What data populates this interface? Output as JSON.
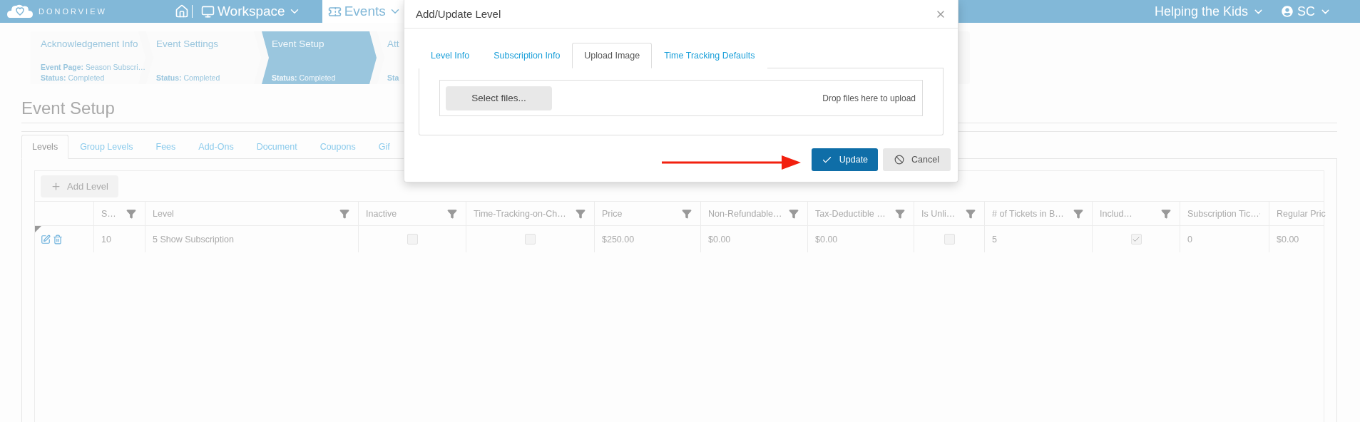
{
  "topbar": {
    "logo": "DONORVIEW",
    "nav": [
      {
        "kind": "workspace",
        "label": "Workspace",
        "selected": false
      },
      {
        "kind": "events",
        "label": "Events",
        "selected": true
      }
    ],
    "organization": "Helping the Kids",
    "user": "SC"
  },
  "steps": [
    {
      "title": "Acknowledgement Info",
      "selected": false,
      "fields": [
        {
          "label": "Event Page:",
          "value": "Season Subscri…"
        },
        {
          "label": "Status:",
          "value": "Completed"
        }
      ]
    },
    {
      "title": "Event Settings",
      "selected": false,
      "fields": [
        {
          "label": "Status:",
          "value": "Completed"
        }
      ]
    },
    {
      "title": "Event Setup",
      "selected": true,
      "fields": [
        {
          "label": "Status:",
          "value": "Completed"
        }
      ]
    },
    {
      "title": "Att",
      "selected": false,
      "fields": [
        {
          "label": "Sta"
        }
      ]
    }
  ],
  "page_title": "Event Setup",
  "tabs": [
    {
      "label": "Levels",
      "selected": true
    },
    {
      "label": "Group Levels",
      "selected": false
    },
    {
      "label": "Fees",
      "selected": false
    },
    {
      "label": "Add-Ons",
      "selected": false
    },
    {
      "label": "Document",
      "selected": false
    },
    {
      "label": "Coupons",
      "selected": false
    },
    {
      "label": "Gif",
      "selected": false
    }
  ],
  "toolbar": {
    "add_button": "Add Level"
  },
  "table": {
    "columns": [
      "S…",
      "Level",
      "Inactive",
      "Time-Tracking-on-Ch…",
      "Price",
      "Non-Refundable…",
      "Tax-Deductible …",
      "Is Unli…",
      "# of Tickets in B…",
      "Includ…",
      "Subscription Tic…",
      "Regular Pric"
    ],
    "rows": [
      {
        "cells": [
          {
            "kind": "text",
            "text": "10"
          },
          {
            "kind": "text",
            "text": "5 Show Subscription"
          },
          {
            "kind": "checkbox",
            "checked": false
          },
          {
            "kind": "checkbox",
            "checked": false
          },
          {
            "kind": "text",
            "text": "$250.00"
          },
          {
            "kind": "text",
            "text": "$0.00"
          },
          {
            "kind": "text",
            "text": "$0.00"
          },
          {
            "kind": "checkbox",
            "checked": false
          },
          {
            "kind": "text",
            "text": "5"
          },
          {
            "kind": "checkbox",
            "checked": true
          },
          {
            "kind": "text",
            "text": "0"
          },
          {
            "kind": "text",
            "text": "$0.00"
          }
        ]
      }
    ]
  },
  "dialog": {
    "title": "Add/Update Level",
    "tabs": [
      {
        "label": "Level Info",
        "selected": false
      },
      {
        "label": "Subscription Info",
        "selected": false
      },
      {
        "label": "Upload Image",
        "selected": true
      },
      {
        "label": "Time Tracking Defaults",
        "selected": false
      }
    ],
    "upload": {
      "button": "Select files...",
      "hint": "Drop files here to upload"
    },
    "buttons": [
      {
        "kind": "primary",
        "label": "Update"
      },
      {
        "kind": "secondary",
        "label": "Cancel"
      }
    ]
  }
}
